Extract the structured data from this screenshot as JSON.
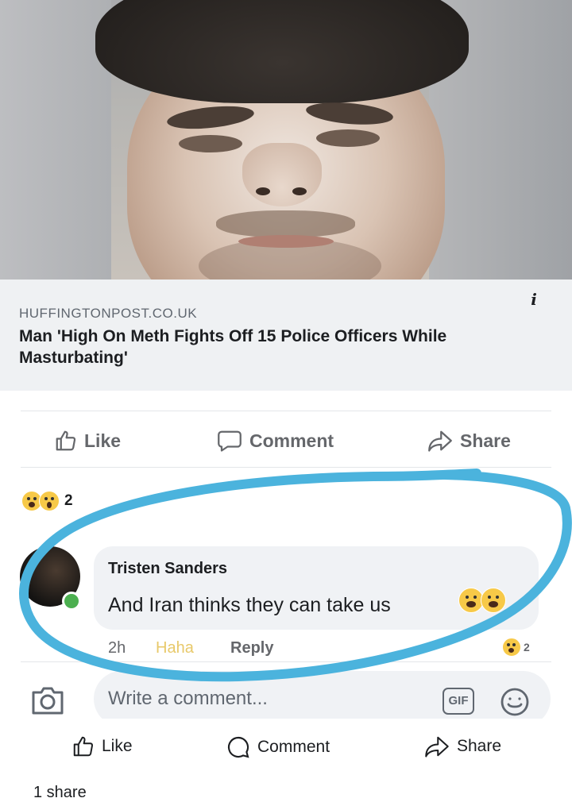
{
  "post": {
    "link_domain": "HUFFINGTONPOST.CO.UK",
    "link_headline": "Man 'High On Meth Fights Off 15 Police Officers While Masturbating'"
  },
  "actions": {
    "like": "Like",
    "comment": "Comment",
    "share": "Share"
  },
  "reactions": {
    "count": "2",
    "icons": [
      "haha-emoji-icon",
      "wow-emoji-icon"
    ]
  },
  "comment": {
    "author": "Tristen Sanders",
    "text": "And Iran thinks they can take us",
    "time": "2h",
    "haha": "Haha",
    "reply": "Reply",
    "reaction_count": "2"
  },
  "composer": {
    "placeholder": "Write a comment..."
  },
  "bottom_actions": {
    "like": "Like",
    "comment": "Comment",
    "share": "Share",
    "share_count": "1 share"
  },
  "colors": {
    "annotation_circle": "#4bb3dd",
    "haha_text": "#e8c96a",
    "online_dot": "#4caf50"
  }
}
